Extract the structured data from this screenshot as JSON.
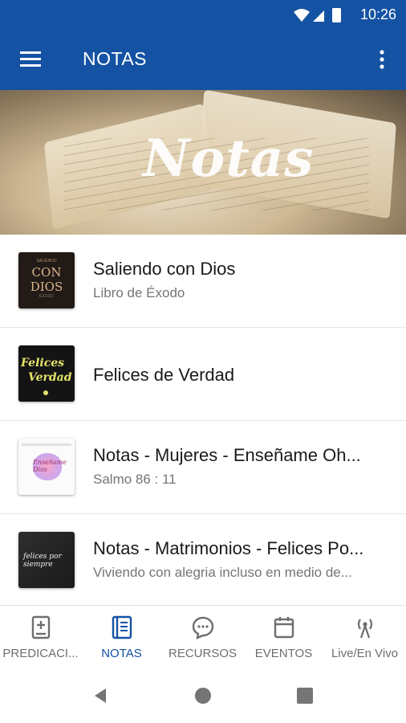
{
  "status_bar": {
    "time": "10:26",
    "icons": [
      "wifi-icon",
      "cell-signal-icon",
      "battery-icon"
    ]
  },
  "app_bar": {
    "title": "NOTAS",
    "icons": [
      "menu-icon",
      "more-vert-icon"
    ]
  },
  "hero": {
    "title": "Notas"
  },
  "notes": [
    {
      "title": "Saliendo con Dios",
      "subtitle": "Libro de Éxodo",
      "thumb": {
        "big": "CON DIOS",
        "small": "SALIENDO",
        "bottom": "ÉXODO"
      }
    },
    {
      "title": "Felices de Verdad",
      "subtitle": "",
      "thumb": {
        "line1": "Felices",
        "line2": "Verdad"
      }
    },
    {
      "title": "Notas - Mujeres - Enseñame Oh...",
      "subtitle": "Salmo 86 : 11",
      "thumb": {
        "text": "Enseñame Dios"
      }
    },
    {
      "title": "Notas - Matrimonios - Felices Po...",
      "subtitle": "Viviendo con alegria incluso en medio de...",
      "thumb": {
        "text": "felices por siempre"
      }
    }
  ],
  "bottom_nav": {
    "items": [
      {
        "label": "PREDICACI...",
        "icon": "book-plus-icon",
        "active": false
      },
      {
        "label": "NOTAS",
        "icon": "notebook-icon",
        "active": true
      },
      {
        "label": "RECURSOS",
        "icon": "chat-bubble-icon",
        "active": false
      },
      {
        "label": "EVENTOS",
        "icon": "calendar-icon",
        "active": false
      },
      {
        "label": "Live/En Vivo",
        "icon": "broadcast-icon",
        "active": false
      }
    ]
  },
  "system_nav": {
    "icons": [
      "back-icon",
      "home-icon",
      "recents-icon"
    ]
  },
  "colors": {
    "primary": "#1452a3",
    "inactive": "#6e6e6e",
    "divider": "#e6e6e6"
  }
}
